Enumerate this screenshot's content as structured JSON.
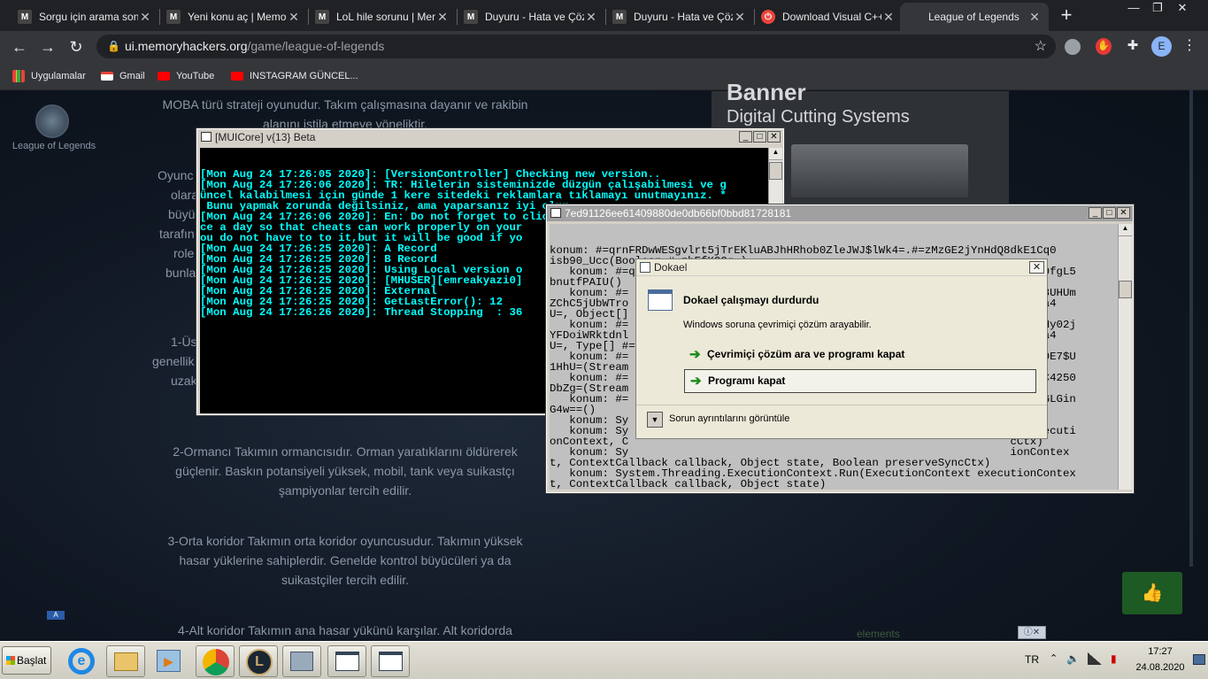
{
  "browser": {
    "tabs": [
      {
        "title": "Sorgu için arama sonu",
        "favicon": "M"
      },
      {
        "title": "Yeni konu aç | Memor",
        "favicon": "M"
      },
      {
        "title": "LoL hile sorunu | Mem",
        "favicon": "M"
      },
      {
        "title": "Duyuru - Hata ve Çöz",
        "favicon": "M"
      },
      {
        "title": "Duyuru - Hata ve Çöz",
        "favicon": "M"
      },
      {
        "title": "Download Visual C++",
        "favicon": "⏻"
      },
      {
        "title": "League of Legends",
        "favicon": ""
      }
    ],
    "url_host": "ui.memoryhackers.org",
    "url_path": "/game/league-of-legends",
    "profile_initial": "E",
    "bookmarks": [
      "Uygulamalar",
      "Gmail",
      "YouTube",
      "INSTAGRAM GÜNCEL..."
    ]
  },
  "page": {
    "logo_label": "League of Legends",
    "ad_text": "Digital Cutting Systems",
    "ad_text_top": "Banner",
    "paragraphs": [
      "MOBA türü strateji oyunudur. Takım çalışmasına dayanır ve rakibin",
      "alanını istila etmeye yöneliktir.",
      "2-Ormancı Takımın ormancısıdır. Orman yaratıklarını öldürerek",
      "güçlenir. Baskın potansiyeli yüksek, mobil, tank veya suikastçı",
      "şampiyonlar tercih edilir.",
      "3-Orta koridor Takımın orta koridor oyuncusudur. Takımın yüksek",
      "hasar yüklerine sahiplerdir. Genelde kontrol büyücüleri ya da",
      "suikastçiler tercih edilir.",
      "4-Alt koridor Takımın ana hasar yükünü karşılar. Alt koridorda"
    ],
    "left_fragments": [
      "Oyunc",
      "olara",
      "büyü",
      "tarafın",
      "role",
      "bunla",
      "1-Üs",
      "genellik",
      "uzak"
    ],
    "ad_footer": "elements",
    "lang_badge": "A"
  },
  "console1": {
    "title": "[MUICore] v{13} Beta",
    "lines": [
      {
        "text": "[Mon Aug 24 17:26:05 2020]: [VersionController] Checking new version..",
        "color": "#00ffff"
      },
      {
        "text": "[Mon Aug 24 17:26:06 2020]: TR: Hilelerin sisteminizde düzgün çalışabilmesi ve g",
        "color": "#00ffff"
      },
      {
        "text": "üncel kalabilmesi için günde 1 kere sitedeki reklamlara tıklamayı unutmayınız. *",
        "color": "#00ffff"
      },
      {
        "text": " Bunu yapmak zorunda değilsiniz, ama yaparsanız iyi olur.",
        "color": "#00ffff"
      },
      {
        "text": "[Mon Aug 24 17:26:06 2020]: En: Do not forget to click on the ads on the site on",
        "color": "#00ffff"
      },
      {
        "text": "ce a day so that cheats can work properly on your",
        "color": "#00ffff"
      },
      {
        "text": "ou do not have to to it,but it will be good if yo",
        "color": "#00ffff"
      },
      {
        "text": "[Mon Aug 24 17:26:25 2020]: A Record",
        "color": "#00ffff"
      },
      {
        "text": "[Mon Aug 24 17:26:25 2020]: B Record",
        "color": "#00ffff"
      },
      {
        "text": "[Mon Aug 24 17:26:25 2020]: Using Local version o",
        "color": "#00ffff"
      },
      {
        "text": "[Mon Aug 24 17:26:25 2020]: [MHUSER][emreakyazi0]",
        "color": "#00ffff"
      },
      {
        "text": "[Mon Aug 24 17:26:25 2020]: External",
        "color": "#00ffff"
      },
      {
        "text": "[Mon Aug 24 17:26:25 2020]: GetLastError(): 12",
        "color": "#00ffff"
      },
      {
        "text": "[Mon Aug 24 17:26:26 2020]: Thread Stopping  : 36",
        "color": "#00ffff"
      }
    ]
  },
  "console2": {
    "title": "7ed91126ee61409880de0db66bf0bbd81728181",
    "lines": [
      "konum: #=qrnFRDwWESgvlrt5jTrEKluABJhHRhob0ZleJWJ$lWk4=.#=zMzGE2jYnHdQ8dkE1Cq0",
      "isb90_Ucc(Boolean #=zhEfKOOg=)",
      "   konum: #=qrnFRDwWESgvlrt5jTrEKluABJhHRhob0ZleJWJ$lWk4=.#=zV6tcQKmMLEmFrB0fgL5",
      "bnutfPAIU()",
      "   konum: #=                                                          06HC98UHUm",
      "ZChC5jUbWTro                                                          =zhK1a4",
      "U=, Object[]",
      "   konum: #=                                                          4FUGBNy02j",
      "YFDoiWRktdnl                                                          =zhK1a4",
      "U=, Type[] #=",
      "   konum: #=                                                          X9pyx0E7$U",
      "1HhU=(Stream",
      "   konum: #=                                                          iEyCUC4250",
      "DbZg=(Stream",
      "   konum: #=                                                          OTP5HGLGin",
      "G4w==()",
      "   konum: Sy                                                          te)",
      "   konum: Sy                                                          xt executi",
      "onContext, C                                                          cCtx)",
      "   konum: Sy                                                          ionContex",
      "t, ContextCallback callback, Object state, Boolean preserveSyncCtx)",
      "   konum: System.Threading.ExecutionContext.Run(ExecutionContext executionContex",
      "t, ContextCallback callback, Object state)",
      "   konum: System.Threading.ThreadHelper.ThreadStart()"
    ]
  },
  "dialog": {
    "title": "Dokael",
    "heading": "Dokael çalışmayı durdurdu",
    "message": "Windows soruna çevrimiçi çözüm arayabilir.",
    "option1": "Çevrimiçi çözüm ara ve programı kapat",
    "option2": "Programı kapat",
    "details": "Sorun ayrıntılarını görüntüle"
  },
  "taskbar": {
    "start_label": "Başlat",
    "lang": "TR",
    "time": "17:27",
    "date": "24.08.2020"
  }
}
